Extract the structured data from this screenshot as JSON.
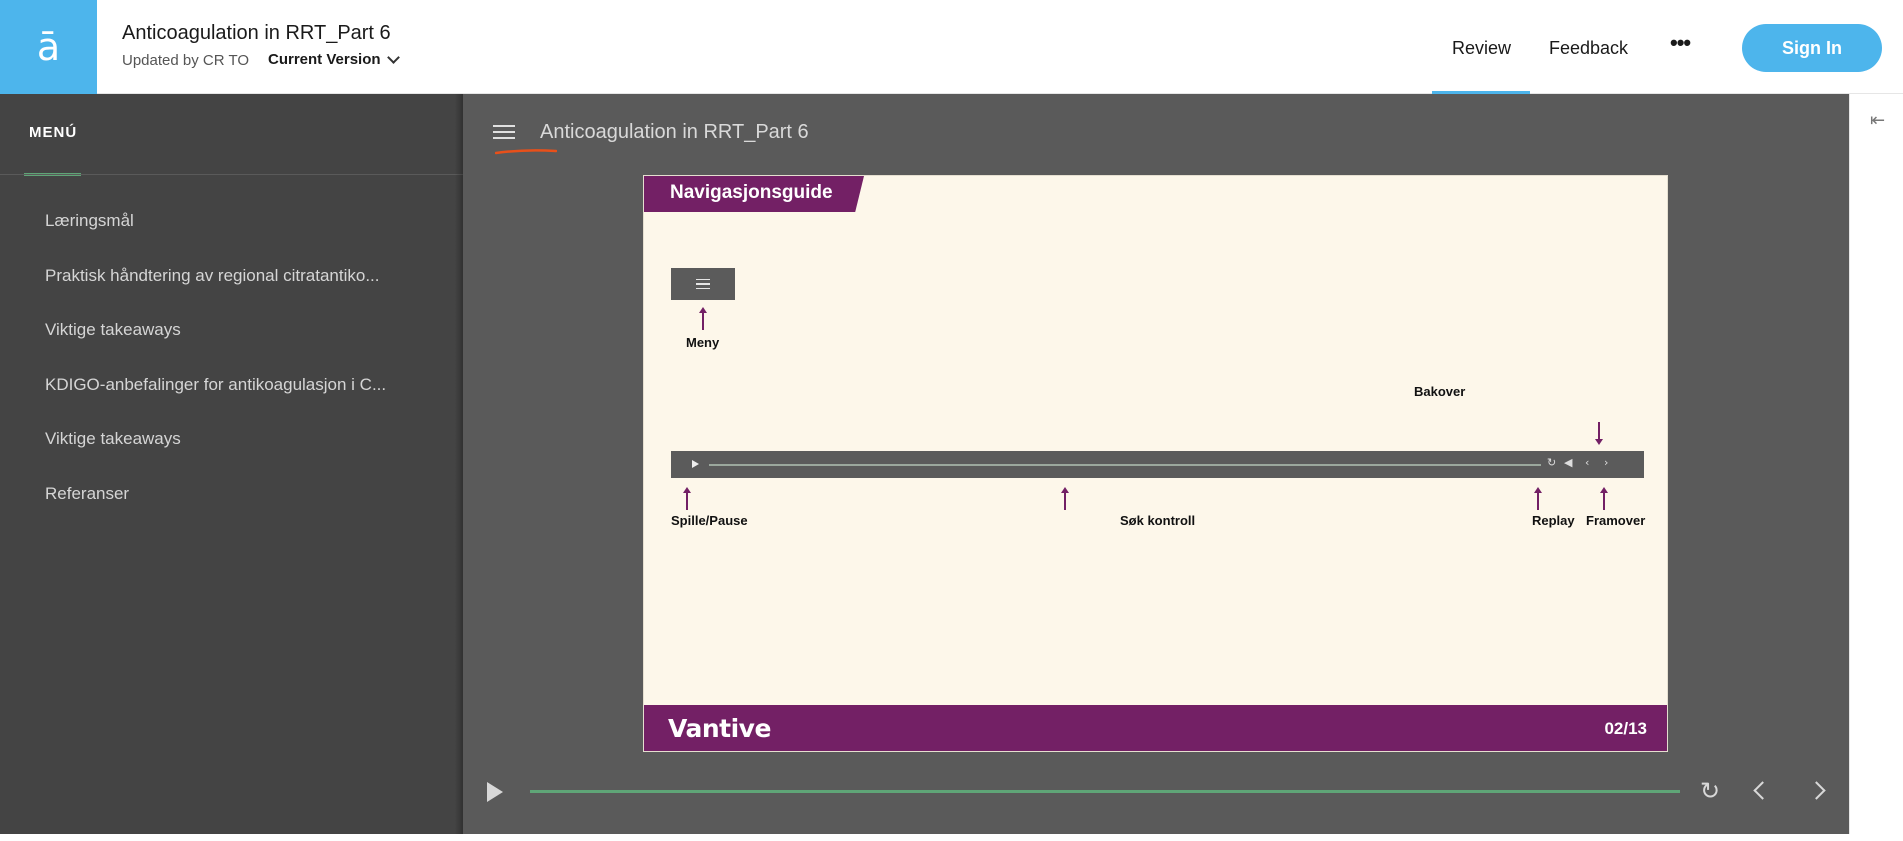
{
  "header": {
    "logo_glyph": "ā",
    "title": "Anticoagulation in RRT_Part 6",
    "updated_by": "Updated by CR TO",
    "version_label": "Current Version",
    "nav": {
      "review": "Review",
      "feedback": "Feedback",
      "more": "•••"
    },
    "sign_in": "Sign In"
  },
  "sidebar": {
    "heading": "MENÚ",
    "items": [
      {
        "label": "Læringsmål"
      },
      {
        "label": "Praktisk håndtering av regional citratantiko..."
      },
      {
        "label": "Viktige takeaways"
      },
      {
        "label": "KDIGO-anbefalinger for antikoagulasjon i C..."
      },
      {
        "label": "Viktige takeaways"
      },
      {
        "label": "Referanser"
      }
    ]
  },
  "stage": {
    "title": "Anticoagulation in RRT_Part 6"
  },
  "slide": {
    "tab_title": "Navigasjonsguide",
    "labels": {
      "menu": "Meny",
      "back": "Bakover",
      "play_pause": "Spille/Pause",
      "seek": "Søk kontroll",
      "replay": "Replay",
      "forward": "Framover"
    },
    "brand": "Vantive",
    "page": "02/13"
  },
  "colors": {
    "accent_blue": "#4db5ec",
    "brand_purple": "#732065",
    "progress_green": "#5fa577",
    "sidebar_bg": "#444444",
    "stage_bg": "#5a5a5a",
    "annotation_orange": "#e8501a"
  },
  "icons": {
    "logo": "logo-icon",
    "hamburger": "hamburger-icon",
    "collapse": "collapse-panel-icon",
    "replay": "replay-icon",
    "prev": "chevron-left-icon",
    "next": "chevron-right-icon"
  }
}
